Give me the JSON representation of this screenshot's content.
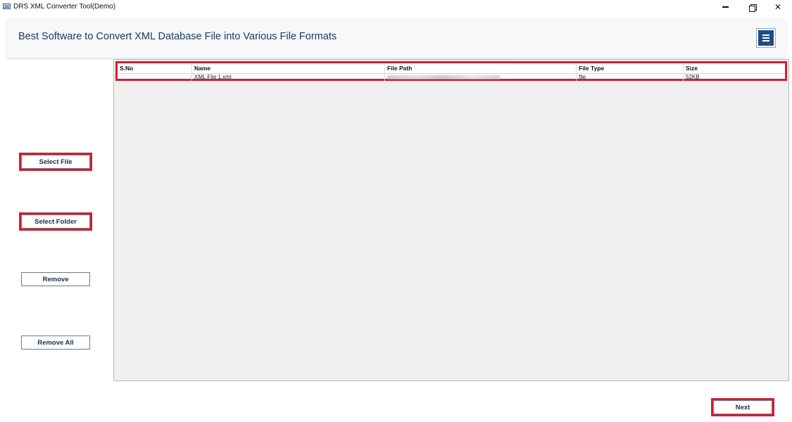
{
  "window": {
    "title": "DRS XML Converter Tool(Demo)",
    "icon": "app-icon",
    "controls": {
      "minimize_icon": "minimize-icon",
      "maximize_icon": "restore-icon",
      "close_label": "✕"
    }
  },
  "header": {
    "title": "Best Software to Convert XML Database File into Various File Formats",
    "menu_icon": "hamburger-menu-icon",
    "menu_color": "#1f4d8a"
  },
  "sidebar": {
    "select_file": "Select File",
    "select_folder": "Select Folder",
    "remove": "Remove",
    "remove_all": "Remove All"
  },
  "table": {
    "columns": [
      "S.No",
      "Name",
      "File Path",
      "File Type",
      "Size"
    ],
    "rows": [
      {
        "sno": "",
        "name": "XML File 1.xml",
        "path": "",
        "type": "file",
        "size": "52KB"
      }
    ]
  },
  "footer": {
    "next": "Next"
  },
  "colors": {
    "highlight": "#d0202e",
    "title_text": "#1d3a64",
    "grid_bg": "#efefef"
  }
}
